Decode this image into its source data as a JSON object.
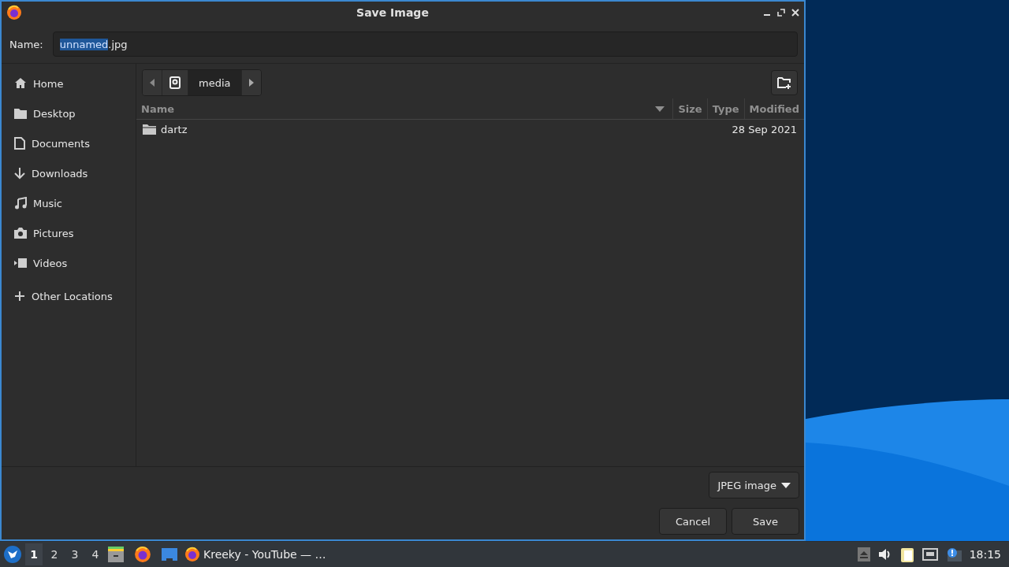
{
  "window": {
    "title": "Save Image"
  },
  "name_field": {
    "label": "Name:",
    "selected_part": "unnamed",
    "unselected_part": ".jpg"
  },
  "sidebar": {
    "items": [
      {
        "label": "Home"
      },
      {
        "label": "Desktop"
      },
      {
        "label": "Documents"
      },
      {
        "label": "Downloads"
      },
      {
        "label": "Music"
      },
      {
        "label": "Pictures"
      },
      {
        "label": "Videos"
      }
    ],
    "other": {
      "label": "Other Locations"
    }
  },
  "path_bar": {
    "segments": [
      {
        "kind": "drive",
        "selected": false
      },
      {
        "kind": "folder",
        "label": "media",
        "selected": true
      }
    ]
  },
  "table": {
    "columns": [
      {
        "label": "Name",
        "sorted": true
      },
      {
        "label": "Size",
        "sorted": false
      },
      {
        "label": "Type",
        "sorted": false
      },
      {
        "label": "Modified",
        "sorted": false
      }
    ],
    "rows": [
      {
        "name": "dartz",
        "modified": "28 Sep 2021"
      }
    ]
  },
  "filter": {
    "value": "JPEG image"
  },
  "buttons": [
    "Cancel",
    "Save"
  ],
  "taskbar": {
    "workspaces": [
      {
        "label": "1",
        "selected": true
      },
      {
        "label": "2",
        "selected": false
      },
      {
        "label": "3",
        "selected": false
      },
      {
        "label": "4",
        "selected": false
      }
    ],
    "task": "Kreeky - YouTube — …",
    "clock": "18:15"
  }
}
